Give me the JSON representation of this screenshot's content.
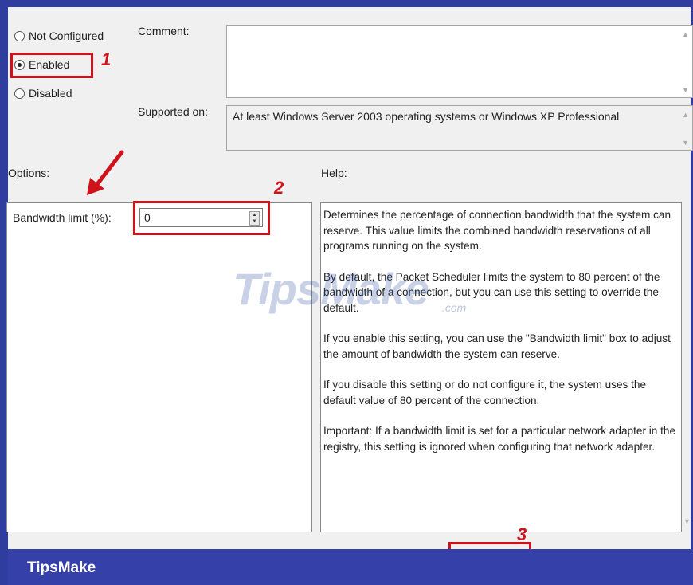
{
  "state": {
    "options": [
      "Not Configured",
      "Enabled",
      "Disabled"
    ],
    "selected": "Enabled"
  },
  "comment": {
    "label": "Comment:",
    "value": ""
  },
  "supported": {
    "label": "Supported on:",
    "value": "At least Windows Server 2003 operating systems or Windows XP Professional"
  },
  "options_section": {
    "label": "Options:",
    "bandwidth_label": "Bandwidth limit (%):",
    "bandwidth_value": "0"
  },
  "help_section": {
    "label": "Help:",
    "paragraphs": [
      "Determines the percentage of connection bandwidth that the system can reserve. This value limits the combined bandwidth reservations of all programs running on the system.",
      "By default, the Packet Scheduler limits the system to 80 percent of the bandwidth of a connection, but you can use this setting to override the default.",
      "If you enable this setting, you can use the \"Bandwidth limit\" box to adjust the amount of bandwidth the system can reserve.",
      "If you disable this setting or do not configure it, the system uses the default value of 80 percent of the connection.",
      "Important: If a bandwidth limit is set for a particular network adapter in the registry, this setting is ignored when configuring that network adapter."
    ]
  },
  "annotations": [
    "1",
    "2",
    "3"
  ],
  "watermark": {
    "text": "TipsMake",
    "suffix": ".com"
  },
  "footer": {
    "brand": "TipsMake"
  },
  "colors": {
    "annotation": "#d0121b",
    "frame": "#2f3d9e",
    "footer": "#3540a8"
  }
}
